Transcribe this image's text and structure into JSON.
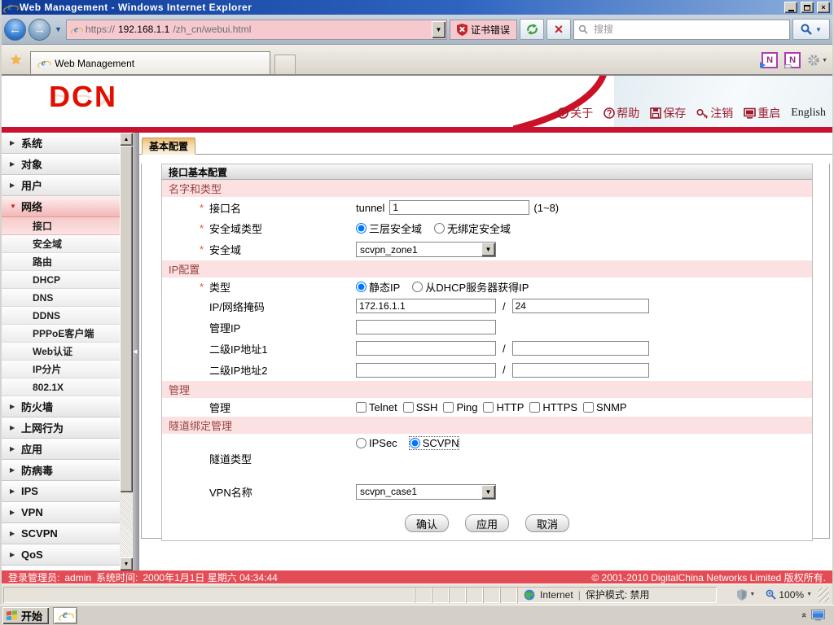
{
  "titlebar": {
    "title": "Web Management - Windows Internet Explorer"
  },
  "nav": {
    "url_scheme": "https://",
    "url_host": "192.168.1.1",
    "url_path": "/zh_cn/webui.html",
    "cert_error": "证书错误",
    "search_placeholder": "搜搜"
  },
  "tabs": {
    "active": "Web Management"
  },
  "header": {
    "logo": "DCN",
    "links": [
      "关于",
      "帮助",
      "保存",
      "注销",
      "重启",
      "English"
    ]
  },
  "sidebar": {
    "items_top": [
      "系统",
      "对象",
      "用户"
    ],
    "network": {
      "label": "网络",
      "children": [
        "接口",
        "安全域",
        "路由",
        "DHCP",
        "DNS",
        "DDNS",
        "PPPoE客户端",
        "Web认证",
        "IP分片",
        "802.1X"
      ]
    },
    "items_bottom": [
      "防火墙",
      "上网行为",
      "应用",
      "防病毒",
      "IPS",
      "VPN",
      "SCVPN",
      "QoS"
    ]
  },
  "form": {
    "tab": "基本配置",
    "title": "接口基本配置",
    "required_mark": "*",
    "slash": "/",
    "sections": {
      "name_type": "名字和类型",
      "ip": "IP配置",
      "mgmt": "管理",
      "tunnel": "隧道绑定管理"
    },
    "fields": {
      "if_name": {
        "label": "接口名",
        "prefix": "tunnel",
        "value": "1",
        "hint": "(1~8)"
      },
      "zone_type": {
        "label": "安全域类型",
        "options": [
          "三层安全域",
          "无绑定安全域"
        ],
        "selected": "三层安全域"
      },
      "zone": {
        "label": "安全域",
        "value": "scvpn_zone1"
      },
      "ip_type": {
        "label": "类型",
        "options": [
          "静态IP",
          "从DHCP服务器获得IP"
        ],
        "selected": "静态IP"
      },
      "ip_mask": {
        "label": "IP/网络掩码",
        "ip": "172.16.1.1",
        "mask": "24"
      },
      "mgmt_ip": {
        "label": "管理IP",
        "value": ""
      },
      "sec_ip1": {
        "label": "二级IP地址1",
        "ip": "",
        "mask": ""
      },
      "sec_ip2": {
        "label": "二级IP地址2",
        "ip": "",
        "mask": ""
      },
      "mgmt": {
        "label": "管理",
        "options": [
          "Telnet",
          "SSH",
          "Ping",
          "HTTP",
          "HTTPS",
          "SNMP"
        ]
      },
      "tunnel_type": {
        "label": "隧道类型",
        "options": [
          "IPSec",
          "SCVPN"
        ],
        "selected": "SCVPN"
      },
      "vpn_name": {
        "label": "VPN名称",
        "value": "scvpn_case1"
      }
    },
    "buttons": [
      "确认",
      "应用",
      "取消"
    ]
  },
  "footer": {
    "login_label": "登录管理员:",
    "admin": "admin",
    "time_label": "系统时间:",
    "time": "2000年1月1日 星期六 04:34:44",
    "copyright": "© 2001-2010 DigitalChina Networks Limited 版权所有."
  },
  "statusbar": {
    "zone": "Internet",
    "divider": "|",
    "protected_mode": "保护模式: 禁用",
    "zoom_level": "100%"
  },
  "taskbar": {
    "start": "开始"
  },
  "icons": {
    "back": "←",
    "forward": "→",
    "caret": "▼",
    "stop": "×",
    "star": "★",
    "tri_right": "▶",
    "tri_down": "▼",
    "scroll_up": "▲",
    "scroll_down": "▼",
    "splitter": "◀",
    "close": "×",
    "onenote": "N",
    "tray_chevron": "«"
  }
}
